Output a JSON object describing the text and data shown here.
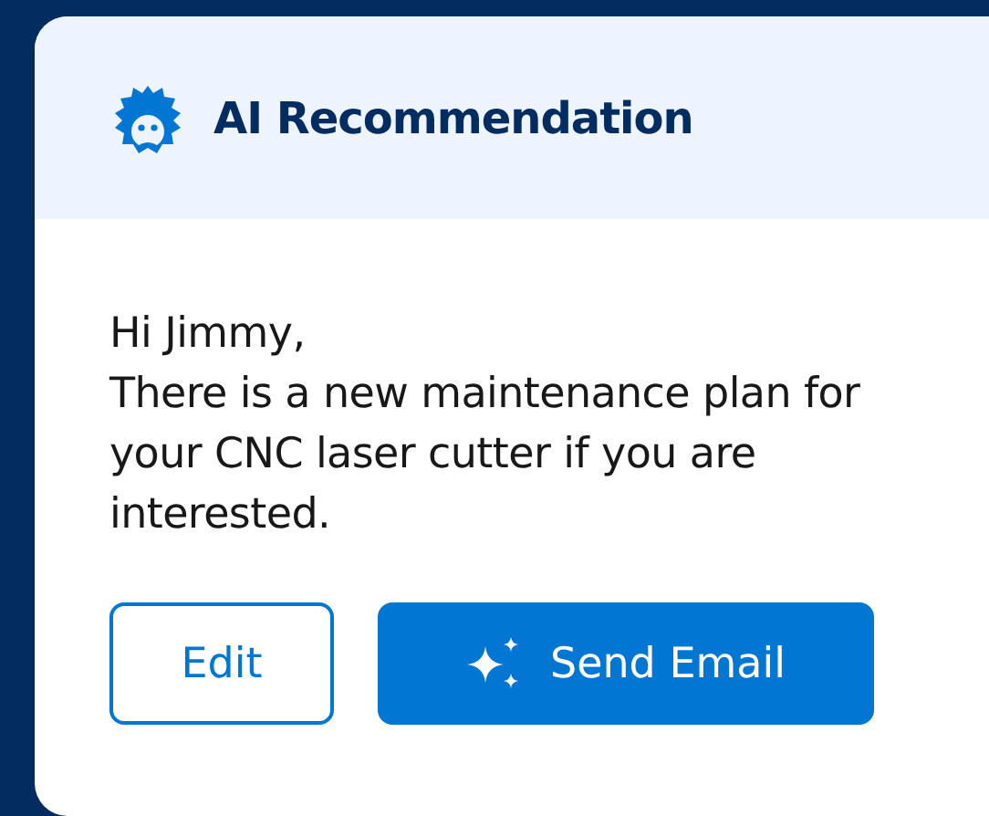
{
  "card": {
    "title": "AI Recommendation",
    "message_lines": [
      "Hi Jimmy,",
      "There is a new maintenance plan for your CNC laser cutter if you are interested."
    ]
  },
  "buttons": [
    {
      "label": "Edit",
      "kind": "outline"
    },
    {
      "label": "Send Email",
      "kind": "brand"
    }
  ]
}
